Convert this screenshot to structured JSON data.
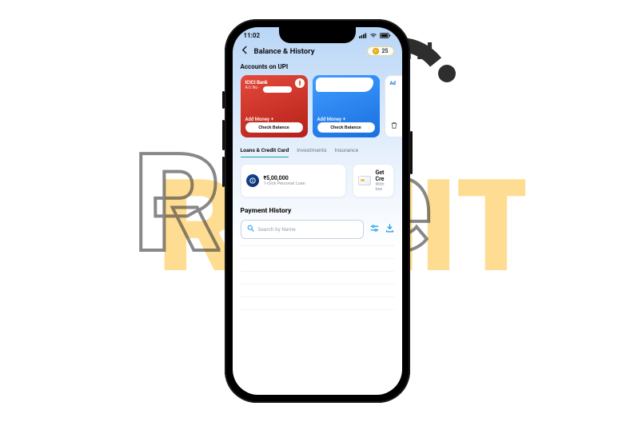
{
  "status": {
    "time": "11:02"
  },
  "header": {
    "title": "Balance & History",
    "coins": "25"
  },
  "sections": {
    "accounts_label": "Accounts on UPI",
    "payment_history": "Payment History"
  },
  "cards": [
    {
      "bank": "ICICI Bank",
      "acct_prefix": "A/c No -",
      "add_money": "Add Money",
      "check": "Check Balance"
    },
    {
      "bank": "",
      "add_money": "Add Money",
      "check": "Check Balance"
    },
    {
      "peek_label": "Ad"
    }
  ],
  "tabs": {
    "t1": "Loans & Credit Card",
    "t2": "Investments",
    "t3": "Insurance"
  },
  "offers": {
    "loan_amount": "₹5,00,000",
    "loan_sub": "1-click Personal Loan",
    "cc_title": "Get Cre",
    "cc_sub": "With bes"
  },
  "search": {
    "placeholder": "Search by Name"
  }
}
